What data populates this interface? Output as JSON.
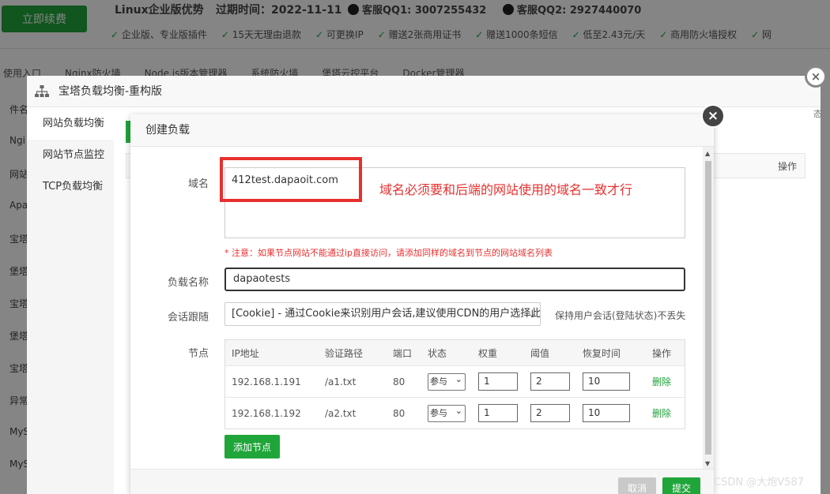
{
  "background": {
    "renew_button": "立即续费",
    "product_title": "Linux企业版优势",
    "expire": "过期时间：2022-11-11",
    "qq1": "客服QQ1: 3007255432",
    "qq2": "客服QQ2: 2927440070",
    "features": [
      "企业版、专业版插件",
      "15天无理由退款",
      "可更换IP",
      "赠送2张商用证书",
      "赠送1000条短信",
      "低至2.43元/天",
      "商用防火墙授权",
      "网"
    ],
    "tabs": [
      "使用入口",
      "Nginx防火墙",
      "Node.js版本管理器",
      "系统防火墙",
      "堡塔云控平台",
      "Docker管理器"
    ],
    "side_items": [
      "件名称",
      "Ngi",
      "网站",
      "Apa",
      "宝塔",
      "堡塔",
      "宝塔",
      "堡塔",
      "宝塔",
      "异常",
      "MyS",
      "MyS",
      "宝塔"
    ]
  },
  "outer_modal": {
    "title": "宝塔负载均衡-重构版",
    "close_icon": "×",
    "menu": [
      "网站负载均衡",
      "网站节点监控",
      "TCP负载均衡"
    ],
    "table_op_header": "操作",
    "edge_label": "态"
  },
  "inner_modal": {
    "title": "创建负载",
    "close_icon": "×",
    "domain_label": "域名",
    "domain_value": "412test.dapaoit.com",
    "annotation": "域名必须要和后端的网站使用的域名一致才行",
    "notice": "* 注意：如果节点网站不能通过ip直接访问，请添加同样的域名到节点的网站域名列表",
    "name_label": "负载名称",
    "name_value": "dapaotests",
    "session_label": "会话跟随",
    "session_value": "[Cookie] - 通过Cookie来识别用户会话,建议使用CDN的用户选择此项",
    "session_tip": "保持用户会话(登陆状态)不丢失",
    "nodes_label": "节点",
    "node_headers": [
      "IP地址",
      "验证路径",
      "端口",
      "状态",
      "权重",
      "阈值",
      "恢复时间",
      "操作"
    ],
    "nodes": [
      {
        "ip": "192.168.1.191",
        "path": "/a1.txt",
        "port": "80",
        "status": "参与",
        "weight": "1",
        "threshold": "2",
        "recover": "10",
        "op": "删除"
      },
      {
        "ip": "192.168.1.192",
        "path": "/a2.txt",
        "port": "80",
        "status": "参与",
        "weight": "1",
        "threshold": "2",
        "recover": "10",
        "op": "删除"
      }
    ],
    "add_node": "添加节点",
    "cancel": "取消",
    "submit": "提交"
  },
  "watermark": "CSDN @大炮V587"
}
